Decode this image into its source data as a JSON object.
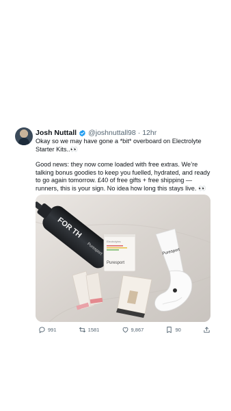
{
  "tweet": {
    "author": {
      "name": "Josh Nuttall",
      "handle": "@joshnuttall98",
      "verified": true,
      "avatar_icon": "profile-photo"
    },
    "separator": "·",
    "time": "12hr",
    "paragraphs": [
      "Okay so we may have gone a *bit* overboard on Electrolyte Starter Kits..👀",
      "Good news: they now come loaded with free extras. We’re talking bonus goodies to keep you fuelled, hydrated, and ready to go again tomorrow. £40 of free gifts + free shipping — runners, this is your sign. No idea how long this stays live. 👀"
    ],
    "media": {
      "bottle_text": "FOR TH",
      "bottle_brand": "Puresport",
      "box_brand": "Puresport",
      "box_label": "Electrolytes",
      "sock_brand": "Puresport"
    },
    "actions": {
      "reply_icon": "reply-icon",
      "reply_count": "991",
      "retweet_icon": "retweet-icon",
      "retweet_count": "1581",
      "like_icon": "heart-icon",
      "like_count": "9,867",
      "bookmark_icon": "bookmark-icon",
      "bookmark_count": "90",
      "share_icon": "share-icon"
    }
  },
  "colors": {
    "text": "#0f1419",
    "muted": "#536471",
    "verified": "#1d9bf0",
    "background": "#ffffff"
  }
}
